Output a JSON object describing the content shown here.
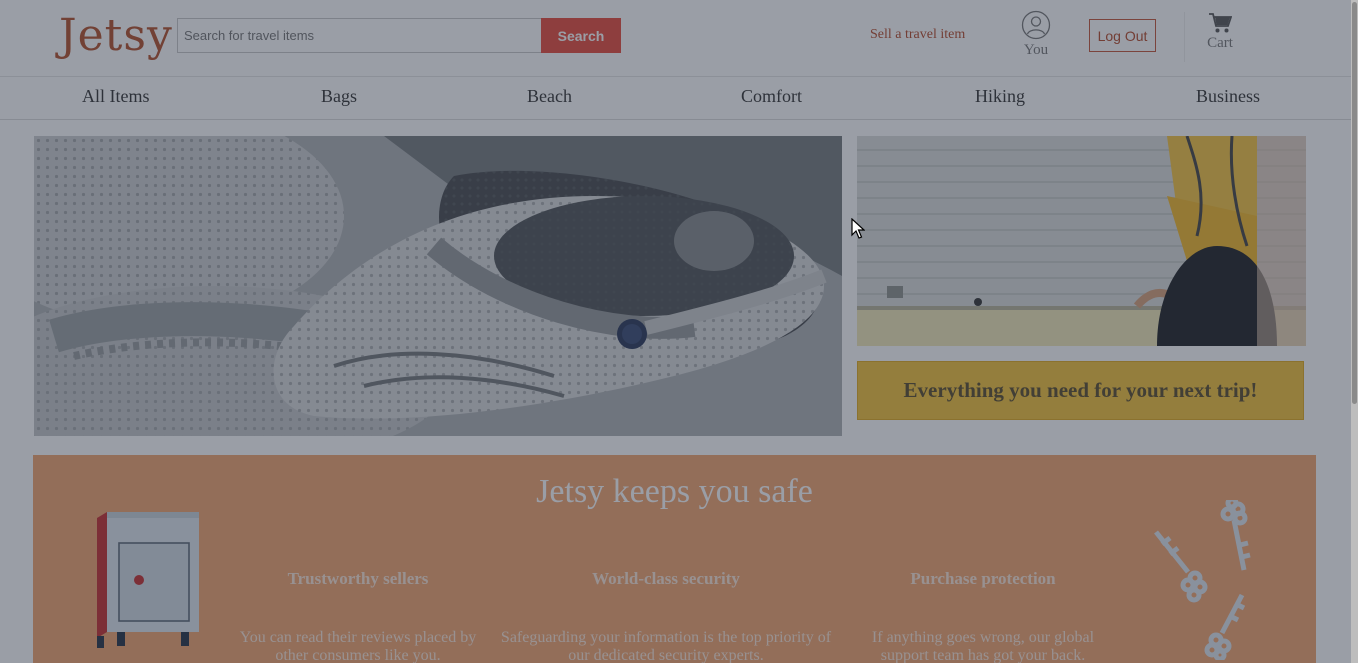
{
  "header": {
    "logo": "Jetsy",
    "search_placeholder": "Search for travel items",
    "search_button": "Search",
    "sell_link": "Sell a travel item",
    "you_label": "You",
    "logout_label": "Log Out",
    "cart_label": "Cart"
  },
  "nav": {
    "items": [
      "All Items",
      "Bags",
      "Beach",
      "Comfort",
      "Hiking",
      "Business"
    ]
  },
  "hero": {
    "slide_index": "1",
    "banner_text": "Everything you need for your next trip!"
  },
  "safety": {
    "title": "Jetsy keeps you safe",
    "features": [
      {
        "title": "Trustworthy sellers",
        "text": "You can read their reviews placed by other consumers like you."
      },
      {
        "title": "World-class security",
        "text": "Safeguarding your information is the top priority of our dedicated security experts."
      },
      {
        "title": "Purchase protection",
        "text": "If anything goes wrong, our global support team has got your back."
      }
    ]
  },
  "colors": {
    "brand": "#b4502a",
    "search_button": "#e84a3c",
    "banner": "#f4c33a",
    "safe_section": "#f2a46f"
  },
  "icons": [
    "user-icon",
    "cart-icon",
    "safe-icon",
    "keys-icon",
    "cursor-icon"
  ]
}
